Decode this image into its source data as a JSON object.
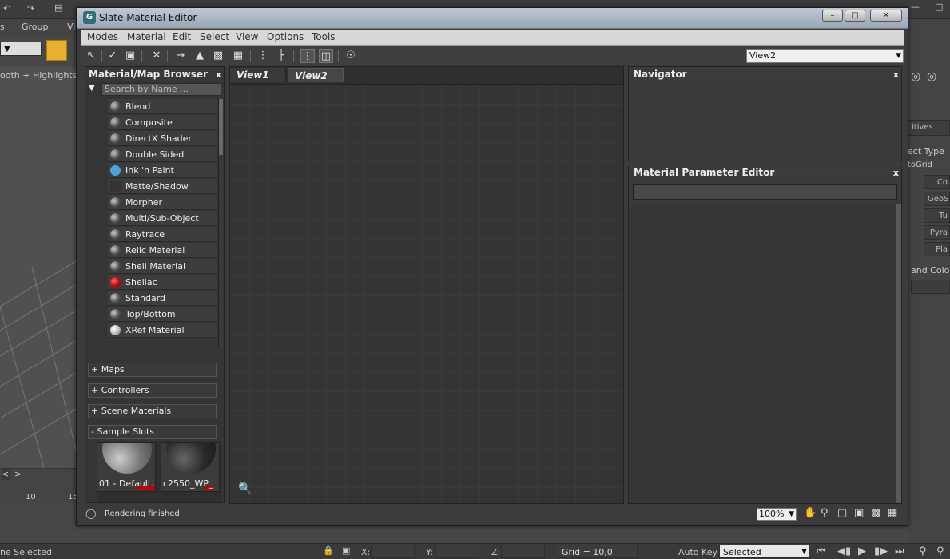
{
  "background": {
    "menu_group": "Group",
    "menu_vi": "Vi",
    "menu_s": "s",
    "viewport_label": "ooth + Highlights ]",
    "timeline_tick": "10",
    "timeline_tick2": "15",
    "status_selected": "ne Selected",
    "coord_x": "X:",
    "coord_y": "Y:",
    "coord_z": "Z:",
    "grid": "Grid = 10,0",
    "auto_key": "Auto Key",
    "auto_key_value": "Selected",
    "right_panel_items": [
      "itives",
      "ect Type",
      "toGrid",
      "Co",
      "GeoSp",
      "Tu",
      "Pyra",
      "Pla",
      "and Color"
    ]
  },
  "window": {
    "title": "Slate Material Editor",
    "minimize": "–",
    "restore": "□",
    "close": "✕"
  },
  "menu": [
    "Modes",
    "Material",
    "Edit",
    "Select",
    "View",
    "Options",
    "Tools"
  ],
  "toolbar": {
    "view_select": "View2"
  },
  "browser": {
    "title": "Material/Map Browser",
    "close": "x",
    "search_placeholder": "Search by Name ...",
    "materials": [
      {
        "label": "Blend",
        "swatch": "sphere"
      },
      {
        "label": "Composite",
        "swatch": "sphere"
      },
      {
        "label": "DirectX Shader",
        "swatch": "sphere"
      },
      {
        "label": "Double Sided",
        "swatch": "sphere"
      },
      {
        "label": "Ink 'n Paint",
        "swatch": "blue"
      },
      {
        "label": "Matte/Shadow",
        "swatch": "none"
      },
      {
        "label": "Morpher",
        "swatch": "sphere"
      },
      {
        "label": "Multi/Sub-Object",
        "swatch": "sphere"
      },
      {
        "label": "Raytrace",
        "swatch": "sphere"
      },
      {
        "label": "Relic Material",
        "swatch": "sphere"
      },
      {
        "label": "Shell Material",
        "swatch": "sphere"
      },
      {
        "label": "Shellac",
        "swatch": "red"
      },
      {
        "label": "Standard",
        "swatch": "sphere"
      },
      {
        "label": "Top/Bottom",
        "swatch": "sphere"
      },
      {
        "label": "XRef Material",
        "swatch": "white"
      }
    ],
    "sections": [
      "+ Maps",
      "+ Controllers",
      "+ Scene Materials",
      "- Sample Slots"
    ],
    "slots": [
      {
        "label": "01 - Default..."
      },
      {
        "label": "c2550_WP_"
      }
    ]
  },
  "views": {
    "tabs": [
      "View1",
      "View2"
    ],
    "active_tab": "View2"
  },
  "navigator": {
    "title": "Navigator",
    "close": "x"
  },
  "param_editor": {
    "title": "Material Parameter Editor",
    "close": "x"
  },
  "status": {
    "text": "Rendering finished",
    "zoom": "100%"
  },
  "colors": {
    "ink_paint_swatch": "#4aa3df",
    "shellac_swatch": "#d40000",
    "slot_red": "#c00000"
  }
}
